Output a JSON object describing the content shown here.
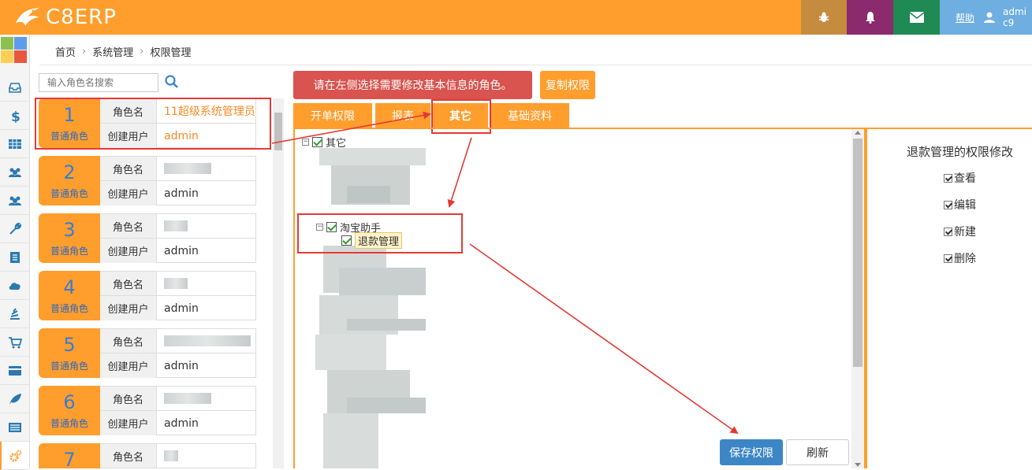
{
  "app": {
    "logo": "C8ERP"
  },
  "topbar": {
    "help_label": "帮助",
    "user_name_line1": "admi",
    "user_name_line2": "c9"
  },
  "breadcrumb": [
    "首页",
    "系统管理",
    "权限管理"
  ],
  "search": {
    "placeholder": "输入角色名搜索"
  },
  "role_labels": {
    "name": "角色名",
    "creator": "创建用户",
    "type": "普通角色"
  },
  "roles": [
    {
      "num": "1",
      "name": "11超级系统管理员",
      "creator": "admin"
    },
    {
      "num": "2",
      "name": "",
      "creator": "admin"
    },
    {
      "num": "3",
      "name": "",
      "creator": "admin"
    },
    {
      "num": "4",
      "name": "",
      "creator": "admin"
    },
    {
      "num": "5",
      "name": "",
      "creator": "admin"
    },
    {
      "num": "6",
      "name": "",
      "creator": "admin"
    },
    {
      "num": "7",
      "name": "",
      "creator": ""
    }
  ],
  "notice": "请在左侧选择需要修改基本信息的角色。",
  "copy_label": "复制权限",
  "tabs": [
    "开单权限",
    "报表",
    "其它",
    "基础资料"
  ],
  "tree": {
    "root": "其它",
    "parent": "淘宝助手",
    "child": "退款管理"
  },
  "actions": {
    "save": "保存权限",
    "refresh": "刷新"
  },
  "perm": {
    "title": "退款管理的权限修改",
    "items": [
      "查看",
      "编辑",
      "新建",
      "删除"
    ]
  },
  "colors": {
    "orange": "#ff9e2c",
    "red": "#d9534f",
    "blue": "#3d86c6"
  }
}
